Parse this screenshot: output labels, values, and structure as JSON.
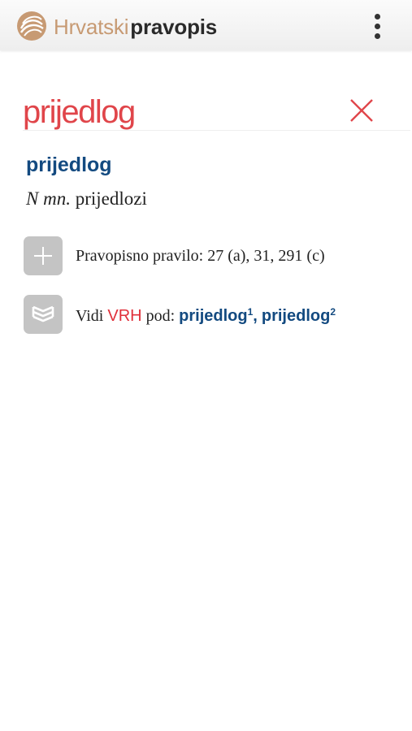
{
  "app": {
    "title_light": "Hrvatski",
    "title_bold": "pravopis",
    "logo_icon": "spiral-logo-icon",
    "menu_icon": "more-vert-icon"
  },
  "search": {
    "value": "prijedlog",
    "clear_icon": "close-icon"
  },
  "entry": {
    "headword": "prijedlog",
    "grammar_abbr": "N mn.",
    "grammar_form": "prijedlozi"
  },
  "rule": {
    "icon": "plus-icon",
    "text": "Pravopisno pravilo: 27 (a), 31, 291 (c)"
  },
  "see_also": {
    "icon": "book-stack-icon",
    "prefix": "Vidi",
    "source": "VRH",
    "middle": "pod:",
    "link1": "prijedlog",
    "link1_sup": "1",
    "separator": ",",
    "link2": "prijedlog",
    "link2_sup": "2"
  },
  "colors": {
    "accent_red": "#e0303a",
    "link_blue": "#134a80",
    "logo_gold": "#c79a73",
    "icon_gray": "#c4c4c4"
  }
}
